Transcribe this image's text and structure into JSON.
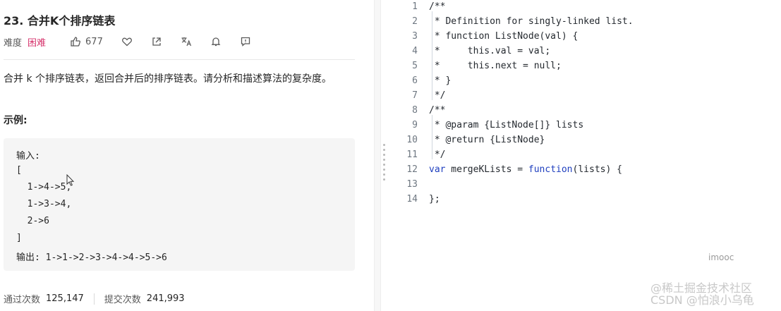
{
  "problem": {
    "title": "23. 合并K个排序链表",
    "difficulty_label": "难度",
    "difficulty": "困难",
    "likes": "677",
    "description": "合并 k 个排序链表，返回合并后的排序链表。请分析和描述算法的复杂度。",
    "example_heading": "示例:",
    "example_lines": [
      "输入:",
      "[",
      "  1->4->5,",
      "  1->3->4,",
      "  2->6",
      "]",
      "输出: 1->1->2->3->4->4->5->6"
    ]
  },
  "stats": {
    "accepted_label": "通过次数",
    "accepted": "125,147",
    "submissions_label": "提交次数",
    "submissions": "241,993"
  },
  "editor": {
    "lines": [
      {
        "n": "1",
        "text": "/**",
        "kind": "comment"
      },
      {
        "n": "2",
        "text": " * Definition for singly-linked list.",
        "kind": "comment"
      },
      {
        "n": "3",
        "text": " * function ListNode(val) {",
        "kind": "comment"
      },
      {
        "n": "4",
        "text": " *     this.val = val;",
        "kind": "comment"
      },
      {
        "n": "5",
        "text": " *     this.next = null;",
        "kind": "comment"
      },
      {
        "n": "6",
        "text": " * }",
        "kind": "comment"
      },
      {
        "n": "7",
        "text": " */",
        "kind": "comment"
      },
      {
        "n": "8",
        "text": "/**",
        "kind": "comment"
      },
      {
        "n": "9",
        "text": " * @param {ListNode[]} lists",
        "kind": "comment"
      },
      {
        "n": "10",
        "text": " * @return {ListNode}",
        "kind": "comment"
      },
      {
        "n": "11",
        "text": " */",
        "kind": "comment"
      },
      {
        "n": "12",
        "text": "var mergeKLists = function(lists) {",
        "kind": "code"
      },
      {
        "n": "13",
        "text": "",
        "kind": "code"
      },
      {
        "n": "14",
        "text": "};",
        "kind": "code"
      }
    ]
  },
  "watermarks": {
    "imooc": "imooc",
    "csdn": "@稀土掘金技术社区\nCSDN @怕浪小乌龟"
  },
  "icons": [
    "like-icon",
    "favorite-icon",
    "share-icon",
    "translate-icon",
    "notify-icon",
    "feedback-icon"
  ]
}
